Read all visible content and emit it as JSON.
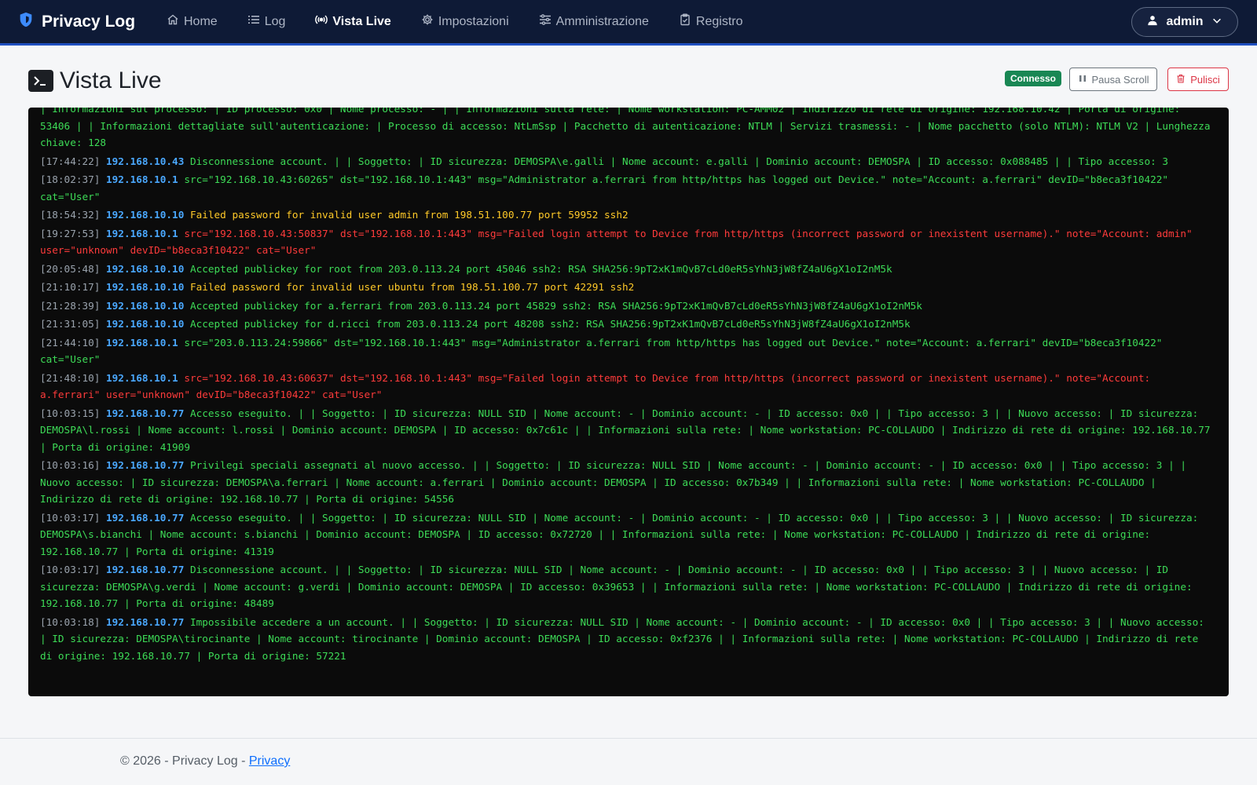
{
  "brand": {
    "name": "Privacy Log",
    "icon": "shield-icon"
  },
  "nav": {
    "items": [
      {
        "label": "Home",
        "icon": "home-icon",
        "active": false
      },
      {
        "label": "Log",
        "icon": "list-icon",
        "active": false
      },
      {
        "label": "Vista Live",
        "icon": "broadcast-icon",
        "active": true
      },
      {
        "label": "Impostazioni",
        "icon": "gear-icon",
        "active": false
      },
      {
        "label": "Amministrazione",
        "icon": "sliders-icon",
        "active": false
      },
      {
        "label": "Registro",
        "icon": "clipboard-icon",
        "active": false
      }
    ]
  },
  "user": {
    "name": "admin",
    "icon": "user-icon"
  },
  "header": {
    "title": "Vista Live",
    "status_badge": "Connesso",
    "pause_label": "Pausa Scroll",
    "clear_label": "Pulisci"
  },
  "log": {
    "partial_line": "| Informazioni sul processo: | ID processo: 0x0 | Nome processo: - | | Informazioni sulla rete: | Nome workstation: PC-AMM02 | Indirizzo di rete di origine: 192.168.10.42 | Porta di origine: 53406 | | Informazioni dettagliate sull'autenticazione: | Processo di accesso: NtLmSsp | Pacchetto di autenticazione: NTLM | Servizi trasmessi: - | Nome pacchetto (solo NTLM): NTLM V2 | Lunghezza chiave: 128",
    "entries": [
      {
        "ts": "[17:44:22]",
        "ip": "192.168.10.43",
        "level": "green",
        "msg": "Disconnessione account. | | Soggetto: | ID sicurezza: DEMOSPA\\e.galli | Nome account: e.galli | Dominio account: DEMOSPA | ID accesso: 0x088485 | | Tipo accesso: 3"
      },
      {
        "ts": "[18:02:37]",
        "ip": "192.168.10.1",
        "level": "green",
        "msg": "src=\"192.168.10.43:60265\" dst=\"192.168.10.1:443\" msg=\"Administrator a.ferrari from http/https has logged out Device.\" note=\"Account: a.ferrari\" devID=\"b8eca3f10422\" cat=\"User\""
      },
      {
        "ts": "[18:54:32]",
        "ip": "192.168.10.10",
        "level": "yellow",
        "msg": "Failed password for invalid user admin from 198.51.100.77 port 59952 ssh2"
      },
      {
        "ts": "[19:27:53]",
        "ip": "192.168.10.1",
        "level": "red",
        "msg": "src=\"192.168.10.43:50837\" dst=\"192.168.10.1:443\" msg=\"Failed login attempt to Device from http/https (incorrect password or inexistent username).\" note=\"Account: admin\" user=\"unknown\" devID=\"b8eca3f10422\" cat=\"User\""
      },
      {
        "ts": "[20:05:48]",
        "ip": "192.168.10.10",
        "level": "green",
        "msg": "Accepted publickey for root from 203.0.113.24 port 45046 ssh2: RSA SHA256:9pT2xK1mQvB7cLd0eR5sYhN3jW8fZ4aU6gX1oI2nM5k"
      },
      {
        "ts": "[21:10:17]",
        "ip": "192.168.10.10",
        "level": "yellow",
        "msg": "Failed password for invalid user ubuntu from 198.51.100.77 port 42291 ssh2"
      },
      {
        "ts": "[21:28:39]",
        "ip": "192.168.10.10",
        "level": "green",
        "msg": "Accepted publickey for a.ferrari from 203.0.113.24 port 45829 ssh2: RSA SHA256:9pT2xK1mQvB7cLd0eR5sYhN3jW8fZ4aU6gX1oI2nM5k"
      },
      {
        "ts": "[21:31:05]",
        "ip": "192.168.10.10",
        "level": "green",
        "msg": "Accepted publickey for d.ricci from 203.0.113.24 port 48208 ssh2: RSA SHA256:9pT2xK1mQvB7cLd0eR5sYhN3jW8fZ4aU6gX1oI2nM5k"
      },
      {
        "ts": "[21:44:10]",
        "ip": "192.168.10.1",
        "level": "green",
        "msg": "src=\"203.0.113.24:59866\" dst=\"192.168.10.1:443\" msg=\"Administrator a.ferrari from http/https has logged out Device.\" note=\"Account: a.ferrari\" devID=\"b8eca3f10422\" cat=\"User\""
      },
      {
        "ts": "[21:48:10]",
        "ip": "192.168.10.1",
        "level": "red",
        "msg": "src=\"192.168.10.43:60637\" dst=\"192.168.10.1:443\" msg=\"Failed login attempt to Device from http/https (incorrect password or inexistent username).\" note=\"Account: a.ferrari\" user=\"unknown\" devID=\"b8eca3f10422\" cat=\"User\""
      },
      {
        "ts": "[10:03:15]",
        "ip": "192.168.10.77",
        "level": "green",
        "msg": "Accesso eseguito. | | Soggetto: | ID sicurezza: NULL SID | Nome account: - | Dominio account: - | ID accesso: 0x0 | | Tipo accesso: 3 | | Nuovo accesso: | ID sicurezza: DEMOSPA\\l.rossi | Nome account: l.rossi | Dominio account: DEMOSPA | ID accesso: 0x7c61c | | Informazioni sulla rete: | Nome workstation: PC-COLLAUDO | Indirizzo di rete di origine: 192.168.10.77 | Porta di origine: 41909"
      },
      {
        "ts": "[10:03:16]",
        "ip": "192.168.10.77",
        "level": "green",
        "msg": "Privilegi speciali assegnati al nuovo accesso. | | Soggetto: | ID sicurezza: NULL SID | Nome account: - | Dominio account: - | ID accesso: 0x0 | | Tipo accesso: 3 | | Nuovo accesso: | ID sicurezza: DEMOSPA\\a.ferrari | Nome account: a.ferrari | Dominio account: DEMOSPA | ID accesso: 0x7b349 | | Informazioni sulla rete: | Nome workstation: PC-COLLAUDO | Indirizzo di rete di origine: 192.168.10.77 | Porta di origine: 54556"
      },
      {
        "ts": "[10:03:17]",
        "ip": "192.168.10.77",
        "level": "green",
        "msg": "Accesso eseguito. | | Soggetto: | ID sicurezza: NULL SID | Nome account: - | Dominio account: - | ID accesso: 0x0 | | Tipo accesso: 3 | | Nuovo accesso: | ID sicurezza: DEMOSPA\\s.bianchi | Nome account: s.bianchi | Dominio account: DEMOSPA | ID accesso: 0x72720 | | Informazioni sulla rete: | Nome workstation: PC-COLLAUDO | Indirizzo di rete di origine: 192.168.10.77 | Porta di origine: 41319"
      },
      {
        "ts": "[10:03:17]",
        "ip": "192.168.10.77",
        "level": "green",
        "msg": "Disconnessione account. | | Soggetto: | ID sicurezza: NULL SID | Nome account: - | Dominio account: - | ID accesso: 0x0 | | Tipo accesso: 3 | | Nuovo accesso: | ID sicurezza: DEMOSPA\\g.verdi | Nome account: g.verdi | Dominio account: DEMOSPA | ID accesso: 0x39653 | | Informazioni sulla rete: | Nome workstation: PC-COLLAUDO | Indirizzo di rete di origine: 192.168.10.77 | Porta di origine: 48489"
      },
      {
        "ts": "[10:03:18]",
        "ip": "192.168.10.77",
        "level": "green",
        "msg": "Impossibile accedere a un account. | | Soggetto: | ID sicurezza: NULL SID | Nome account: - | Dominio account: - | ID accesso: 0x0 | | Tipo accesso: 3 | | Nuovo accesso: | ID sicurezza: DEMOSPA\\tirocinante | Nome account: tirocinante | Dominio account: DEMOSPA | ID accesso: 0xf2376 | | Informazioni sulla rete: | Nome workstation: PC-COLLAUDO | Indirizzo di rete di origine: 192.168.10.77 | Porta di origine: 57221"
      }
    ]
  },
  "footer": {
    "text": "© 2026 - Privacy Log - ",
    "link_label": "Privacy"
  },
  "colors": {
    "navbar_bg": "#0e1a36",
    "accent_line": "#1f4fbf",
    "log_green": "#3ddc57",
    "log_yellow": "#ffc928",
    "log_red": "#ff3b3b",
    "log_ip": "#4aa8ff",
    "badge_green": "#198754",
    "danger": "#dc3545"
  }
}
